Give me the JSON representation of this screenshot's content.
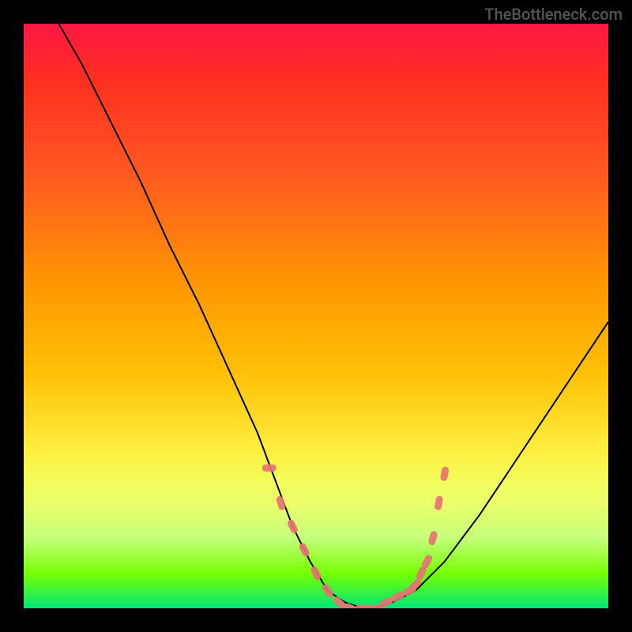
{
  "watermark": "TheBottleneck.com",
  "chart_data": {
    "type": "line",
    "title": "",
    "xlabel": "",
    "ylabel": "",
    "xlim": [
      0,
      100
    ],
    "ylim": [
      0,
      100
    ],
    "series": [
      {
        "name": "curve",
        "x": [
          6,
          10,
          15,
          20,
          25,
          30,
          35,
          40,
          43,
          46,
          49,
          52,
          55,
          58,
          60,
          63,
          67,
          72,
          78,
          84,
          90,
          96,
          100
        ],
        "y": [
          100,
          93,
          83,
          73,
          62,
          52,
          41,
          30,
          22,
          14,
          8,
          3,
          1,
          0,
          0,
          1,
          3,
          8,
          16,
          25,
          34,
          43,
          49
        ]
      },
      {
        "name": "highlight-markers",
        "x": [
          42,
          44,
          46,
          48,
          50,
          52,
          54,
          56,
          58,
          60,
          62,
          64,
          66,
          67,
          68,
          69,
          70,
          71,
          72
        ],
        "y": [
          24,
          18,
          14,
          10,
          6,
          3,
          1,
          0,
          0,
          0,
          1,
          2,
          3,
          4,
          6,
          8,
          12,
          18,
          23
        ]
      }
    ],
    "gradient_colors": {
      "top": "#ff1744",
      "mid_upper": "#ff9800",
      "mid": "#ffeb3b",
      "mid_lower": "#c5ff7a",
      "bottom": "#00e676"
    },
    "curve_color": "#000000",
    "marker_color": "#e57373"
  }
}
